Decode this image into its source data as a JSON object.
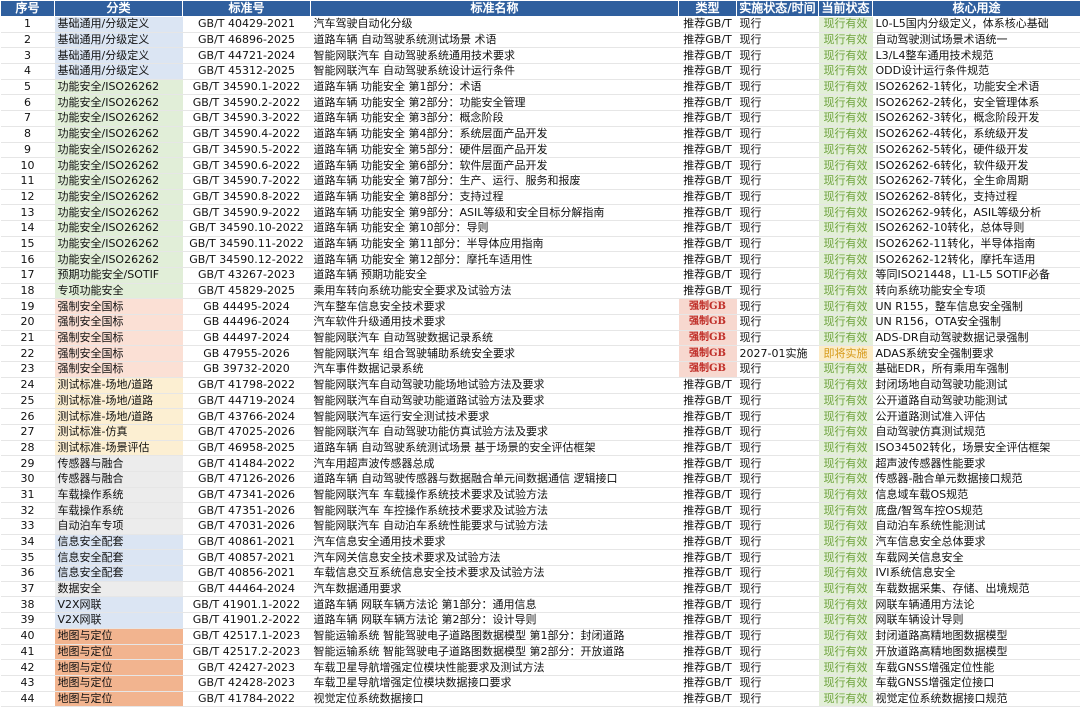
{
  "header": {
    "no": "序号",
    "category": "分类",
    "code": "标准号",
    "name": "标准名称",
    "type": "类型",
    "impl": "实施状态/时间",
    "status": "当前状态",
    "use": "核心用途"
  },
  "rows": [
    {
      "no": "1",
      "cat": "基础通用/分级定义",
      "k": "base",
      "code": "GB/T 40429-2021",
      "name": "汽车驾驶自动化分级",
      "type": "推荐GB/T",
      "impl": "现行",
      "status": "现行有效",
      "st": "valid",
      "use": "L0-L5国内分级定义，体系核心基础"
    },
    {
      "no": "2",
      "cat": "基础通用/分级定义",
      "k": "base",
      "code": "GB/T 46896-2025",
      "name": "道路车辆 自动驾驶系统测试场景 术语",
      "type": "推荐GB/T",
      "impl": "现行",
      "status": "现行有效",
      "st": "valid",
      "use": "自动驾驶测试场景术语统一"
    },
    {
      "no": "3",
      "cat": "基础通用/分级定义",
      "k": "base",
      "code": "GB/T 44721-2024",
      "name": "智能网联汽车 自动驾驶系统通用技术要求",
      "type": "推荐GB/T",
      "impl": "现行",
      "status": "现行有效",
      "st": "valid",
      "use": "L3/L4整车通用技术规范"
    },
    {
      "no": "4",
      "cat": "基础通用/分级定义",
      "k": "base",
      "code": "GB/T 45312-2025",
      "name": "智能网联汽车 自动驾驶系统设计运行条件",
      "type": "推荐GB/T",
      "impl": "现行",
      "status": "现行有效",
      "st": "valid",
      "use": "ODD设计运行条件规范"
    },
    {
      "no": "5",
      "cat": "功能安全/ISO26262",
      "k": "func",
      "code": "GB/T 34590.1-2022",
      "name": "道路车辆 功能安全 第1部分：术语",
      "type": "推荐GB/T",
      "impl": "现行",
      "status": "现行有效",
      "st": "valid",
      "use": "ISO26262-1转化，功能安全术语"
    },
    {
      "no": "6",
      "cat": "功能安全/ISO26262",
      "k": "func",
      "code": "GB/T 34590.2-2022",
      "name": "道路车辆 功能安全 第2部分：功能安全管理",
      "type": "推荐GB/T",
      "impl": "现行",
      "status": "现行有效",
      "st": "valid",
      "use": "ISO26262-2转化，安全管理体系"
    },
    {
      "no": "7",
      "cat": "功能安全/ISO26262",
      "k": "func",
      "code": "GB/T 34590.3-2022",
      "name": "道路车辆 功能安全 第3部分：概念阶段",
      "type": "推荐GB/T",
      "impl": "现行",
      "status": "现行有效",
      "st": "valid",
      "use": "ISO26262-3转化，概念阶段开发"
    },
    {
      "no": "8",
      "cat": "功能安全/ISO26262",
      "k": "func",
      "code": "GB/T 34590.4-2022",
      "name": "道路车辆 功能安全 第4部分：系统层面产品开发",
      "type": "推荐GB/T",
      "impl": "现行",
      "status": "现行有效",
      "st": "valid",
      "use": "ISO26262-4转化，系统级开发"
    },
    {
      "no": "9",
      "cat": "功能安全/ISO26262",
      "k": "func",
      "code": "GB/T 34590.5-2022",
      "name": "道路车辆 功能安全 第5部分：硬件层面产品开发",
      "type": "推荐GB/T",
      "impl": "现行",
      "status": "现行有效",
      "st": "valid",
      "use": "ISO26262-5转化，硬件级开发"
    },
    {
      "no": "10",
      "cat": "功能安全/ISO26262",
      "k": "func",
      "code": "GB/T 34590.6-2022",
      "name": "道路车辆 功能安全 第6部分：软件层面产品开发",
      "type": "推荐GB/T",
      "impl": "现行",
      "status": "现行有效",
      "st": "valid",
      "use": "ISO26262-6转化，软件级开发"
    },
    {
      "no": "11",
      "cat": "功能安全/ISO26262",
      "k": "func",
      "code": "GB/T 34590.7-2022",
      "name": "道路车辆 功能安全 第7部分：生产、运行、服务和报废",
      "type": "推荐GB/T",
      "impl": "现行",
      "status": "现行有效",
      "st": "valid",
      "use": "ISO26262-7转化，全生命周期"
    },
    {
      "no": "12",
      "cat": "功能安全/ISO26262",
      "k": "func",
      "code": "GB/T 34590.8-2022",
      "name": "道路车辆 功能安全 第8部分：支持过程",
      "type": "推荐GB/T",
      "impl": "现行",
      "status": "现行有效",
      "st": "valid",
      "use": "ISO26262-8转化，支持过程"
    },
    {
      "no": "13",
      "cat": "功能安全/ISO26262",
      "k": "func",
      "code": "GB/T 34590.9-2022",
      "name": "道路车辆 功能安全 第9部分：ASIL等级和安全目标分解指南",
      "type": "推荐GB/T",
      "impl": "现行",
      "status": "现行有效",
      "st": "valid",
      "use": "ISO26262-9转化，ASIL等级分析"
    },
    {
      "no": "14",
      "cat": "功能安全/ISO26262",
      "k": "func",
      "code": "GB/T 34590.10-2022",
      "name": "道路车辆 功能安全 第10部分：导则",
      "type": "推荐GB/T",
      "impl": "现行",
      "status": "现行有效",
      "st": "valid",
      "use": "ISO26262-10转化，总体导则"
    },
    {
      "no": "15",
      "cat": "功能安全/ISO26262",
      "k": "func",
      "code": "GB/T 34590.11-2022",
      "name": "道路车辆 功能安全 第11部分：半导体应用指南",
      "type": "推荐GB/T",
      "impl": "现行",
      "status": "现行有效",
      "st": "valid",
      "use": "ISO26262-11转化，半导体指南"
    },
    {
      "no": "16",
      "cat": "功能安全/ISO26262",
      "k": "func",
      "code": "GB/T 34590.12-2022",
      "name": "道路车辆 功能安全 第12部分：摩托车适用性",
      "type": "推荐GB/T",
      "impl": "现行",
      "status": "现行有效",
      "st": "valid",
      "use": "ISO26262-12转化，摩托车适用"
    },
    {
      "no": "17",
      "cat": "预期功能安全/SOTIF",
      "k": "sotif",
      "code": "GB/T 43267-2023",
      "name": "道路车辆 预期功能安全",
      "type": "推荐GB/T",
      "impl": "现行",
      "status": "现行有效",
      "st": "valid",
      "use": "等同ISO21448，L1-L5 SOTIF必备"
    },
    {
      "no": "18",
      "cat": "专项功能安全",
      "k": "special",
      "code": "GB/T 45829-2025",
      "name": "乘用车转向系统功能安全要求及试验方法",
      "type": "推荐GB/T",
      "impl": "现行",
      "status": "现行有效",
      "st": "valid",
      "use": "转向系统功能安全专项"
    },
    {
      "no": "19",
      "cat": "强制安全国标",
      "k": "forced",
      "code": "GB 44495-2024",
      "name": "汽车整车信息安全技术要求",
      "type": "强制GB",
      "tt": "forced",
      "impl": "现行",
      "status": "现行有效",
      "st": "valid",
      "use": "UN R155，整车信息安全强制"
    },
    {
      "no": "20",
      "cat": "强制安全国标",
      "k": "forced",
      "code": "GB 44496-2024",
      "name": "汽车软件升级通用技术要求",
      "type": "强制GB",
      "tt": "forced",
      "impl": "现行",
      "status": "现行有效",
      "st": "valid",
      "use": "UN R156，OTA安全强制"
    },
    {
      "no": "21",
      "cat": "强制安全国标",
      "k": "forced",
      "code": "GB 44497-2024",
      "name": "智能网联汽车 自动驾驶数据记录系统",
      "type": "强制GB",
      "tt": "forced",
      "impl": "现行",
      "status": "现行有效",
      "st": "valid",
      "use": "ADS-DR自动驾驶数据记录强制"
    },
    {
      "no": "22",
      "cat": "强制安全国标",
      "k": "forced",
      "code": "GB 47955-2026",
      "name": "智能网联汽车 组合驾驶辅助系统安全要求",
      "type": "强制GB",
      "tt": "forced",
      "impl": "2027-01实施",
      "status": "即将实施",
      "st": "soon",
      "use": "ADAS系统安全强制要求"
    },
    {
      "no": "23",
      "cat": "强制安全国标",
      "k": "forced",
      "code": "GB 39732-2020",
      "name": "汽车事件数据记录系统",
      "type": "强制GB",
      "tt": "forced",
      "impl": "现行",
      "status": "现行有效",
      "st": "valid",
      "use": "基础EDR，所有乘用车强制"
    },
    {
      "no": "24",
      "cat": "测试标准-场地/道路",
      "k": "test",
      "code": "GB/T 41798-2022",
      "name": "智能网联汽车自动驾驶功能场地试验方法及要求",
      "type": "推荐GB/T",
      "impl": "现行",
      "status": "现行有效",
      "st": "valid",
      "use": "封闭场地自动驾驶功能测试"
    },
    {
      "no": "25",
      "cat": "测试标准-场地/道路",
      "k": "test",
      "code": "GB/T 44719-2024",
      "name": "智能网联汽车自动驾驶功能道路试验方法及要求",
      "type": "推荐GB/T",
      "impl": "现行",
      "status": "现行有效",
      "st": "valid",
      "use": "公开道路自动驾驶功能测试"
    },
    {
      "no": "26",
      "cat": "测试标准-场地/道路",
      "k": "test",
      "code": "GB/T 43766-2024",
      "name": "智能网联汽车运行安全测试技术要求",
      "type": "推荐GB/T",
      "impl": "现行",
      "status": "现行有效",
      "st": "valid",
      "use": "公开道路测试准入评估"
    },
    {
      "no": "27",
      "cat": "测试标准-仿真",
      "k": "test",
      "code": "GB/T 47025-2026",
      "name": "智能网联汽车 自动驾驶功能仿真试验方法及要求",
      "type": "推荐GB/T",
      "impl": "现行",
      "status": "现行有效",
      "st": "valid",
      "use": "自动驾驶仿真测试规范"
    },
    {
      "no": "28",
      "cat": "测试标准-场景评估",
      "k": "test",
      "code": "GB/T 46958-2025",
      "name": "道路车辆 自动驾驶系统测试场景 基于场景的安全评估框架",
      "type": "推荐GB/T",
      "impl": "现行",
      "status": "现行有效",
      "st": "valid",
      "use": "ISO34502转化，场景安全评估框架"
    },
    {
      "no": "29",
      "cat": "传感器与融合",
      "k": "sensor",
      "code": "GB/T 41484-2022",
      "name": "汽车用超声波传感器总成",
      "type": "推荐GB/T",
      "impl": "现行",
      "status": "现行有效",
      "st": "valid",
      "use": "超声波传感器性能要求"
    },
    {
      "no": "30",
      "cat": "传感器与融合",
      "k": "sensor",
      "code": "GB/T 47126-2026",
      "name": "道路车辆 自动驾驶传感器与数据融合单元间数据通信 逻辑接口",
      "type": "推荐GB/T",
      "impl": "现行",
      "status": "现行有效",
      "st": "valid",
      "use": "传感器-融合单元数据接口规范"
    },
    {
      "no": "31",
      "cat": "车载操作系统",
      "k": "sensor",
      "code": "GB/T 47341-2026",
      "name": "智能网联汽车 车载操作系统技术要求及试验方法",
      "type": "推荐GB/T",
      "impl": "现行",
      "status": "现行有效",
      "st": "valid",
      "use": "信息域车载OS规范"
    },
    {
      "no": "32",
      "cat": "车载操作系统",
      "k": "sensor",
      "code": "GB/T 47351-2026",
      "name": "智能网联汽车 车控操作系统技术要求及试验方法",
      "type": "推荐GB/T",
      "impl": "现行",
      "status": "现行有效",
      "st": "valid",
      "use": "底盘/智驾车控OS规范"
    },
    {
      "no": "33",
      "cat": "自动泊车专项",
      "k": "sensor",
      "code": "GB/T 47031-2026",
      "name": "智能网联汽车 自动泊车系统性能要求与试验方法",
      "type": "推荐GB/T",
      "impl": "现行",
      "status": "现行有效",
      "st": "valid",
      "use": "自动泊车系统性能测试"
    },
    {
      "no": "34",
      "cat": "信息安全配套",
      "k": "sec",
      "code": "GB/T 40861-2021",
      "name": "汽车信息安全通用技术要求",
      "type": "推荐GB/T",
      "impl": "现行",
      "status": "现行有效",
      "st": "valid",
      "use": "汽车信息安全总体要求"
    },
    {
      "no": "35",
      "cat": "信息安全配套",
      "k": "sec",
      "code": "GB/T 40857-2021",
      "name": "汽车网关信息安全技术要求及试验方法",
      "type": "推荐GB/T",
      "impl": "现行",
      "status": "现行有效",
      "st": "valid",
      "use": "车载网关信息安全"
    },
    {
      "no": "36",
      "cat": "信息安全配套",
      "k": "sec",
      "code": "GB/T 40856-2021",
      "name": "车载信息交互系统信息安全技术要求及试验方法",
      "type": "推荐GB/T",
      "impl": "现行",
      "status": "现行有效",
      "st": "valid",
      "use": "IVI系统信息安全"
    },
    {
      "no": "37",
      "cat": "数据安全",
      "k": "data",
      "code": "GB/T 44464-2024",
      "name": "汽车数据通用要求",
      "type": "推荐GB/T",
      "impl": "现行",
      "status": "现行有效",
      "st": "valid",
      "use": "车载数据采集、存储、出境规范"
    },
    {
      "no": "38",
      "cat": "V2X网联",
      "k": "v2x",
      "code": "GB/T 41901.1-2022",
      "name": "道路车辆 网联车辆方法论 第1部分：通用信息",
      "type": "推荐GB/T",
      "impl": "现行",
      "status": "现行有效",
      "st": "valid",
      "use": "网联车辆通用方法论"
    },
    {
      "no": "39",
      "cat": "V2X网联",
      "k": "v2x",
      "code": "GB/T 41901.2-2022",
      "name": "道路车辆 网联车辆方法论 第2部分：设计导则",
      "type": "推荐GB/T",
      "impl": "现行",
      "status": "现行有效",
      "st": "valid",
      "use": "网联车辆设计导则"
    },
    {
      "no": "40",
      "cat": "地图与定位",
      "k": "map",
      "code": "GB/T 42517.1-2023",
      "name": "智能运输系统 智能驾驶电子道路图数据模型 第1部分：封闭道路",
      "type": "推荐GB/T",
      "impl": "现行",
      "status": "现行有效",
      "st": "valid",
      "use": "封闭道路高精地图数据模型"
    },
    {
      "no": "41",
      "cat": "地图与定位",
      "k": "map",
      "code": "GB/T 42517.2-2023",
      "name": "智能运输系统 智能驾驶电子道路图数据模型 第2部分：开放道路",
      "type": "推荐GB/T",
      "impl": "现行",
      "status": "现行有效",
      "st": "valid",
      "use": "开放道路高精地图数据模型"
    },
    {
      "no": "42",
      "cat": "地图与定位",
      "k": "map",
      "code": "GB/T 42427-2023",
      "name": "车载卫星导航增强定位模块性能要求及测试方法",
      "type": "推荐GB/T",
      "impl": "现行",
      "status": "现行有效",
      "st": "valid",
      "use": "车载GNSS增强定位性能"
    },
    {
      "no": "43",
      "cat": "地图与定位",
      "k": "map",
      "code": "GB/T 42428-2023",
      "name": "车载卫星导航增强定位模块数据接口要求",
      "type": "推荐GB/T",
      "impl": "现行",
      "status": "现行有效",
      "st": "valid",
      "use": "车载GNSS增强定位接口"
    },
    {
      "no": "44",
      "cat": "地图与定位",
      "k": "map",
      "code": "GB/T 41784-2022",
      "name": "视觉定位系统数据接口",
      "type": "推荐GB/T",
      "impl": "现行",
      "status": "现行有效",
      "st": "valid",
      "use": "视觉定位系统数据接口规范"
    }
  ]
}
